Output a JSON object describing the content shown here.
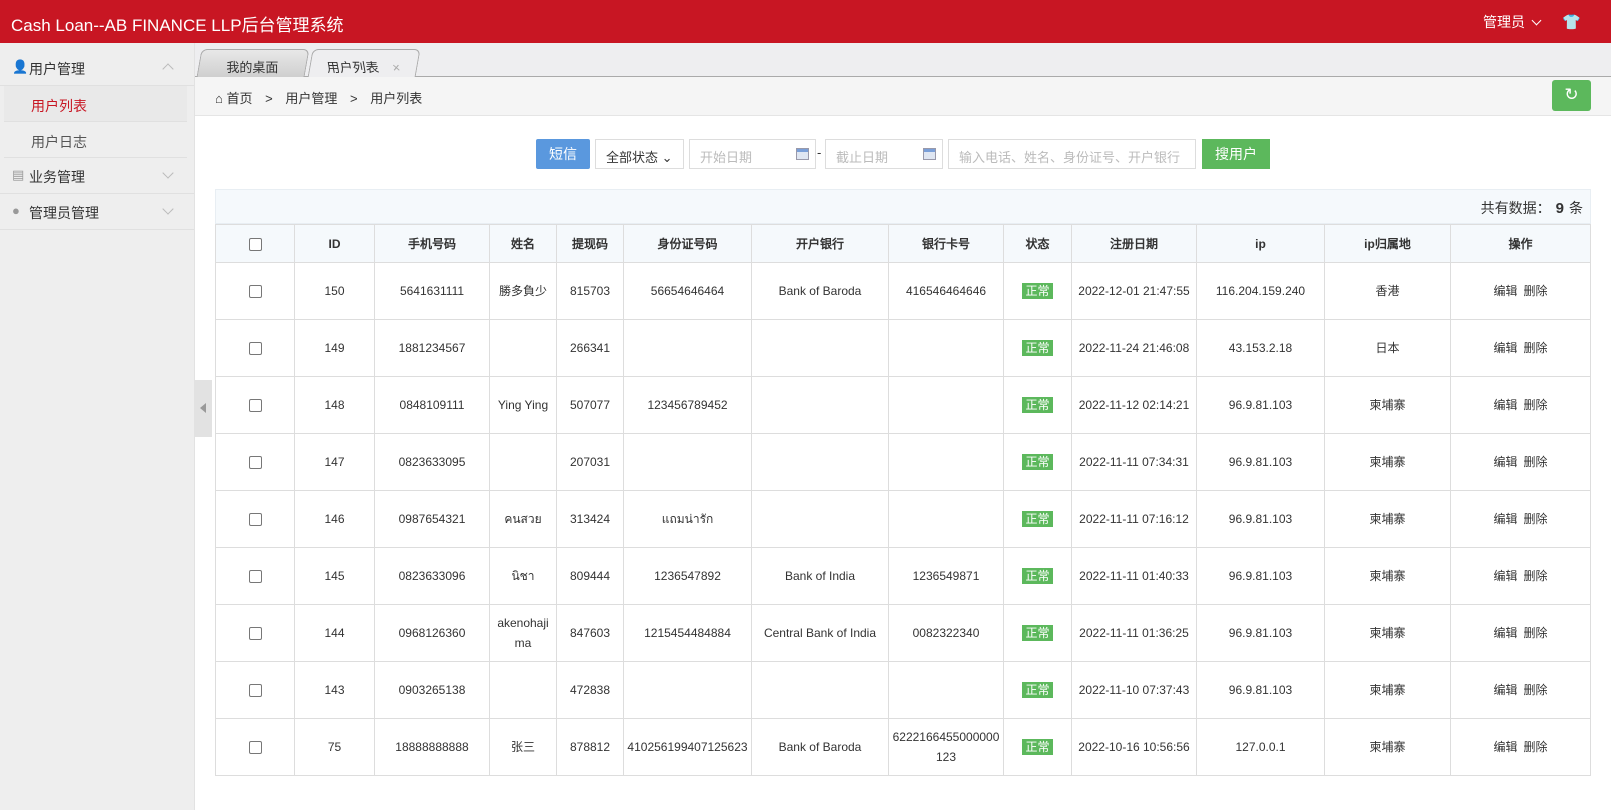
{
  "header": {
    "title": "Cash Loan--AB FINANCE LLP后台管理系统",
    "admin_label": "管理员",
    "skin_icon": "tshirt-icon"
  },
  "sidebar": {
    "groups": [
      {
        "label": "用户管理",
        "icon": "user-icon",
        "expanded": true,
        "items": [
          {
            "label": "用户列表",
            "active": true
          },
          {
            "label": "用户日志",
            "active": false
          }
        ]
      },
      {
        "label": "业务管理",
        "icon": "book-icon",
        "expanded": false
      },
      {
        "label": "管理员管理",
        "icon": "admin-icon",
        "expanded": false
      }
    ]
  },
  "tabs": [
    {
      "label": "我的桌面"
    },
    {
      "label": "用户列表",
      "close": "×"
    }
  ],
  "breadcrumb": {
    "home": "首页",
    "sep": ">",
    "items": [
      "用户管理",
      "用户列表"
    ]
  },
  "toolbar": {
    "sms_label": "短信",
    "status_select": "全部状态",
    "start_placeholder": "开始日期",
    "dash": "-",
    "end_placeholder": "截止日期",
    "search_placeholder": "输入电话、姓名、身份证号、开户银行",
    "search_label": "搜用户"
  },
  "summary": {
    "prefix": "共有数据：",
    "count": "9",
    "suffix": "条"
  },
  "table": {
    "headers": [
      "ID",
      "手机号码",
      "姓名",
      "提现码",
      "身份证号码",
      "开户银行",
      "银行卡号",
      "状态",
      "注册日期",
      "ip",
      "ip归属地",
      "操作"
    ],
    "actions": {
      "edit": "编辑",
      "delete": "删除"
    },
    "rows": [
      {
        "id": "150",
        "phone": "5641631111",
        "name": "勝多負少",
        "code": "815703",
        "idcard": "56654646464",
        "bank": "Bank of Baroda",
        "card": "416546464646",
        "status": "正常",
        "date": "2022-12-01 21:47:55",
        "ip": "116.204.159.240",
        "loc": "香港"
      },
      {
        "id": "149",
        "phone": "1881234567",
        "name": "",
        "code": "266341",
        "idcard": "",
        "bank": "",
        "card": "",
        "status": "正常",
        "date": "2022-11-24 21:46:08",
        "ip": "43.153.2.18",
        "loc": "日本"
      },
      {
        "id": "148",
        "phone": "0848109111",
        "name": "Ying Ying",
        "code": "507077",
        "idcard": "123456789452",
        "bank": "",
        "card": "",
        "status": "正常",
        "date": "2022-11-12 02:14:21",
        "ip": "96.9.81.103",
        "loc": "柬埔寨"
      },
      {
        "id": "147",
        "phone": "0823633095",
        "name": "",
        "code": "207031",
        "idcard": "",
        "bank": "",
        "card": "",
        "status": "正常",
        "date": "2022-11-11 07:34:31",
        "ip": "96.9.81.103",
        "loc": "柬埔寨"
      },
      {
        "id": "146",
        "phone": "0987654321",
        "name": "คนสวย",
        "code": "313424",
        "idcard": "แถมน่ารัก",
        "bank": "",
        "card": "",
        "status": "正常",
        "date": "2022-11-11 07:16:12",
        "ip": "96.9.81.103",
        "loc": "柬埔寨"
      },
      {
        "id": "145",
        "phone": "0823633096",
        "name": "นิชา",
        "code": "809444",
        "idcard": "1236547892",
        "bank": "Bank of India",
        "card": "1236549871",
        "status": "正常",
        "date": "2022-11-11 01:40:33",
        "ip": "96.9.81.103",
        "loc": "柬埔寨"
      },
      {
        "id": "144",
        "phone": "0968126360",
        "name": "akenohajima",
        "code": "847603",
        "idcard": "1215454484884",
        "bank": "Central Bank of India",
        "card": "0082322340",
        "status": "正常",
        "date": "2022-11-11 01:36:25",
        "ip": "96.9.81.103",
        "loc": "柬埔寨"
      },
      {
        "id": "143",
        "phone": "0903265138",
        "name": "",
        "code": "472838",
        "idcard": "",
        "bank": "",
        "card": "",
        "status": "正常",
        "date": "2022-11-10 07:37:43",
        "ip": "96.9.81.103",
        "loc": "柬埔寨"
      },
      {
        "id": "75",
        "phone": "18888888888",
        "name": "张三",
        "code": "878812",
        "idcard": "410256199407125623",
        "bank": "Bank of Baroda",
        "card": "6222166455000000123",
        "status": "正常",
        "date": "2022-10-16 10:56:56",
        "ip": "127.0.0.1",
        "loc": "柬埔寨"
      }
    ]
  },
  "colors": {
    "brand": "#c81623",
    "success": "#5cb85c",
    "primary": "#5a98de"
  }
}
